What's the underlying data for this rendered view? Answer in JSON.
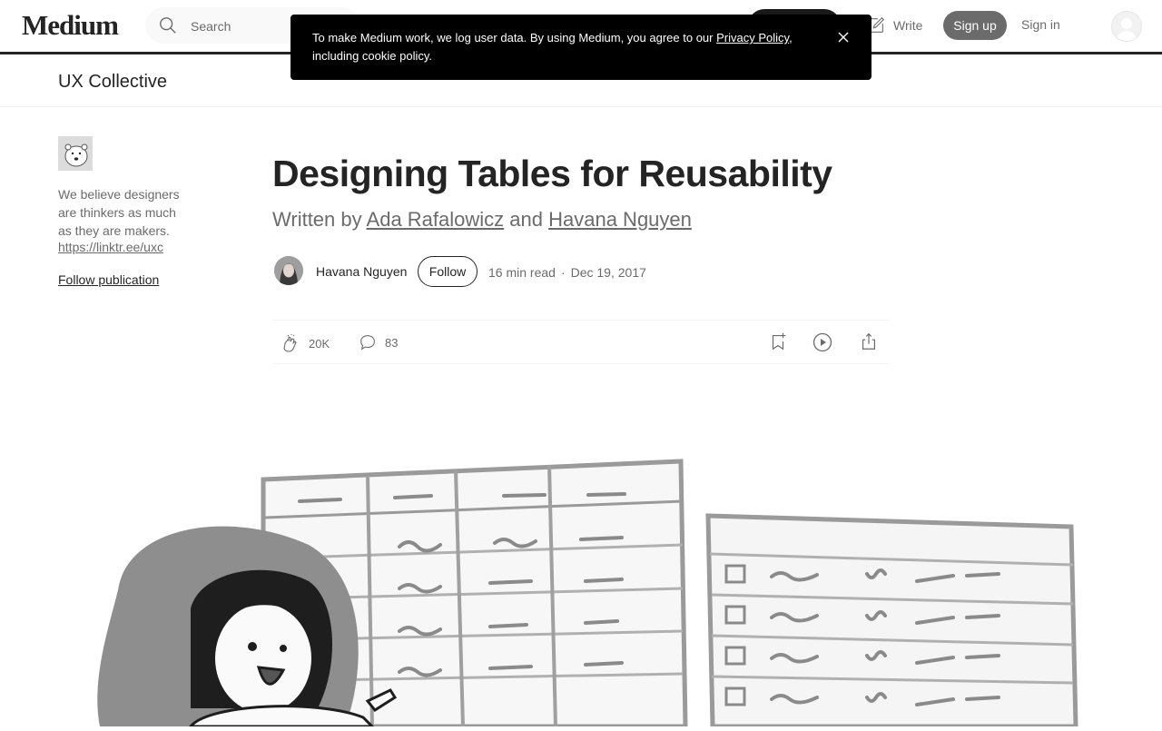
{
  "nav": {
    "logo": "Medium",
    "search_placeholder": "Search",
    "write_label": "Write",
    "signup_label": "Sign up",
    "signin_label": "Sign in"
  },
  "cookie_banner": {
    "text_before": "To make Medium work, we log user data. By using Medium, you agree to our ",
    "link_text": "Privacy Policy",
    "text_after": ", including cookie policy."
  },
  "publication": {
    "name": "UX Collective",
    "description": "We believe designers are thinkers as much as they are makers.",
    "link": "https://linktr.ee/uxc",
    "follow_label": "Follow publication"
  },
  "article": {
    "title": "Designing Tables for Reusability",
    "subtitle_prefix": "Written by ",
    "author1": "Ada Rafalowicz",
    "subtitle_and": " and ",
    "author2": "Havana Nguyen",
    "author_name": "Havana Nguyen",
    "follow_label": "Follow",
    "read_time": "16 min read",
    "date": "Dec 19, 2017",
    "claps": "20K",
    "responses": "83"
  },
  "colors": {
    "text": "#242424",
    "muted": "#6b6b6b",
    "banner_bg": "#000000",
    "signup_bg": "#6b6b6b"
  }
}
